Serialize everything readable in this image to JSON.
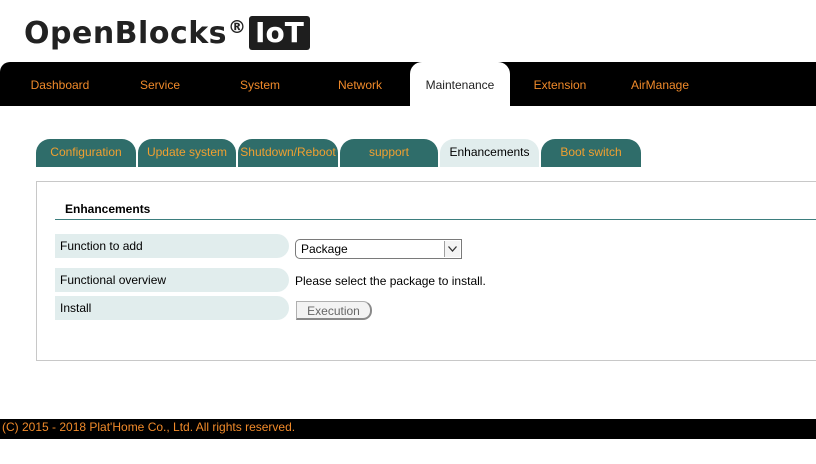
{
  "logo": {
    "name": "OpenBlocks",
    "reg": "®",
    "badge": "IoT"
  },
  "nav": {
    "items": [
      {
        "label": "Dashboard"
      },
      {
        "label": "Service"
      },
      {
        "label": "System"
      },
      {
        "label": "Network"
      },
      {
        "label": "Maintenance",
        "active": true
      },
      {
        "label": "Extension"
      },
      {
        "label": "AirManage"
      }
    ]
  },
  "subtabs": [
    {
      "label": "Configuration"
    },
    {
      "label": "Update system"
    },
    {
      "label": "Shutdown/Reboot"
    },
    {
      "label": "support"
    },
    {
      "label": "Enhancements",
      "active": true
    },
    {
      "label": "Boot switch"
    }
  ],
  "section": {
    "title": "Enhancements",
    "rows": {
      "function_label": "Function to add",
      "function_value": "Package",
      "overview_label": "Functional overview",
      "overview_value": "Please select the package to install.",
      "install_label": "Install",
      "install_button": "Execution"
    }
  },
  "footer": {
    "text": "(C) 2015 - 2018 Plat'Home Co., Ltd. All rights reserved."
  },
  "colors": {
    "nav_bg": "#000000",
    "accent": "#f08a2a",
    "tab_bg": "#2f6d6a",
    "tab_active_bg": "#e1eded",
    "rule": "#3d7e7e"
  }
}
